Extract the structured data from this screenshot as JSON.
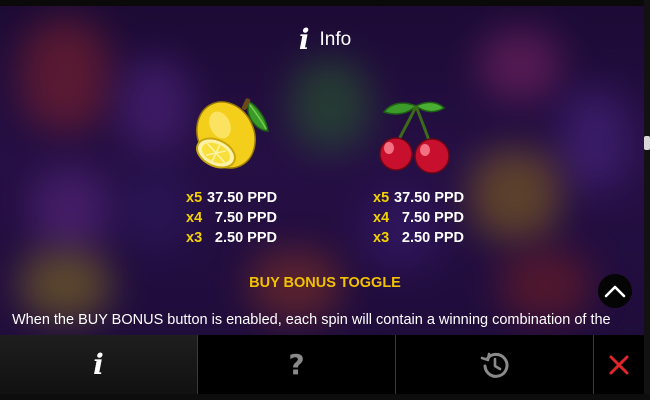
{
  "header": {
    "title": "Info",
    "icon": "info-icon"
  },
  "symbols": [
    {
      "name": "lemon",
      "icon": "lemon-icon",
      "payouts": [
        {
          "mult": "x5",
          "amount": "37.50 PPD"
        },
        {
          "mult": "x4",
          "amount": "7.50 PPD"
        },
        {
          "mult": "x3",
          "amount": "2.50 PPD"
        }
      ]
    },
    {
      "name": "cherries",
      "icon": "cherries-icon",
      "payouts": [
        {
          "mult": "x5",
          "amount": "37.50 PPD"
        },
        {
          "mult": "x4",
          "amount": "7.50 PPD"
        },
        {
          "mult": "x3",
          "amount": "2.50 PPD"
        }
      ]
    }
  ],
  "section": {
    "title": "BUY BONUS TOGGLE",
    "body": "When the BUY BONUS button is enabled, each spin will contain a winning combination of the selected BONUS. During the BUY BONUS feature, the bet button allows you to select a bonus"
  },
  "nav": {
    "tabs": [
      {
        "name": "info",
        "icon": "info-icon",
        "active": true
      },
      {
        "name": "help",
        "icon": "question-icon",
        "active": false
      },
      {
        "name": "history",
        "icon": "history-icon",
        "active": false
      },
      {
        "name": "close",
        "icon": "close-icon",
        "active": false
      }
    ]
  },
  "colors": {
    "multiplier": "#f2d200",
    "section_title": "#f2c200",
    "close_x": "#e0262b",
    "background": "#3a1766"
  }
}
